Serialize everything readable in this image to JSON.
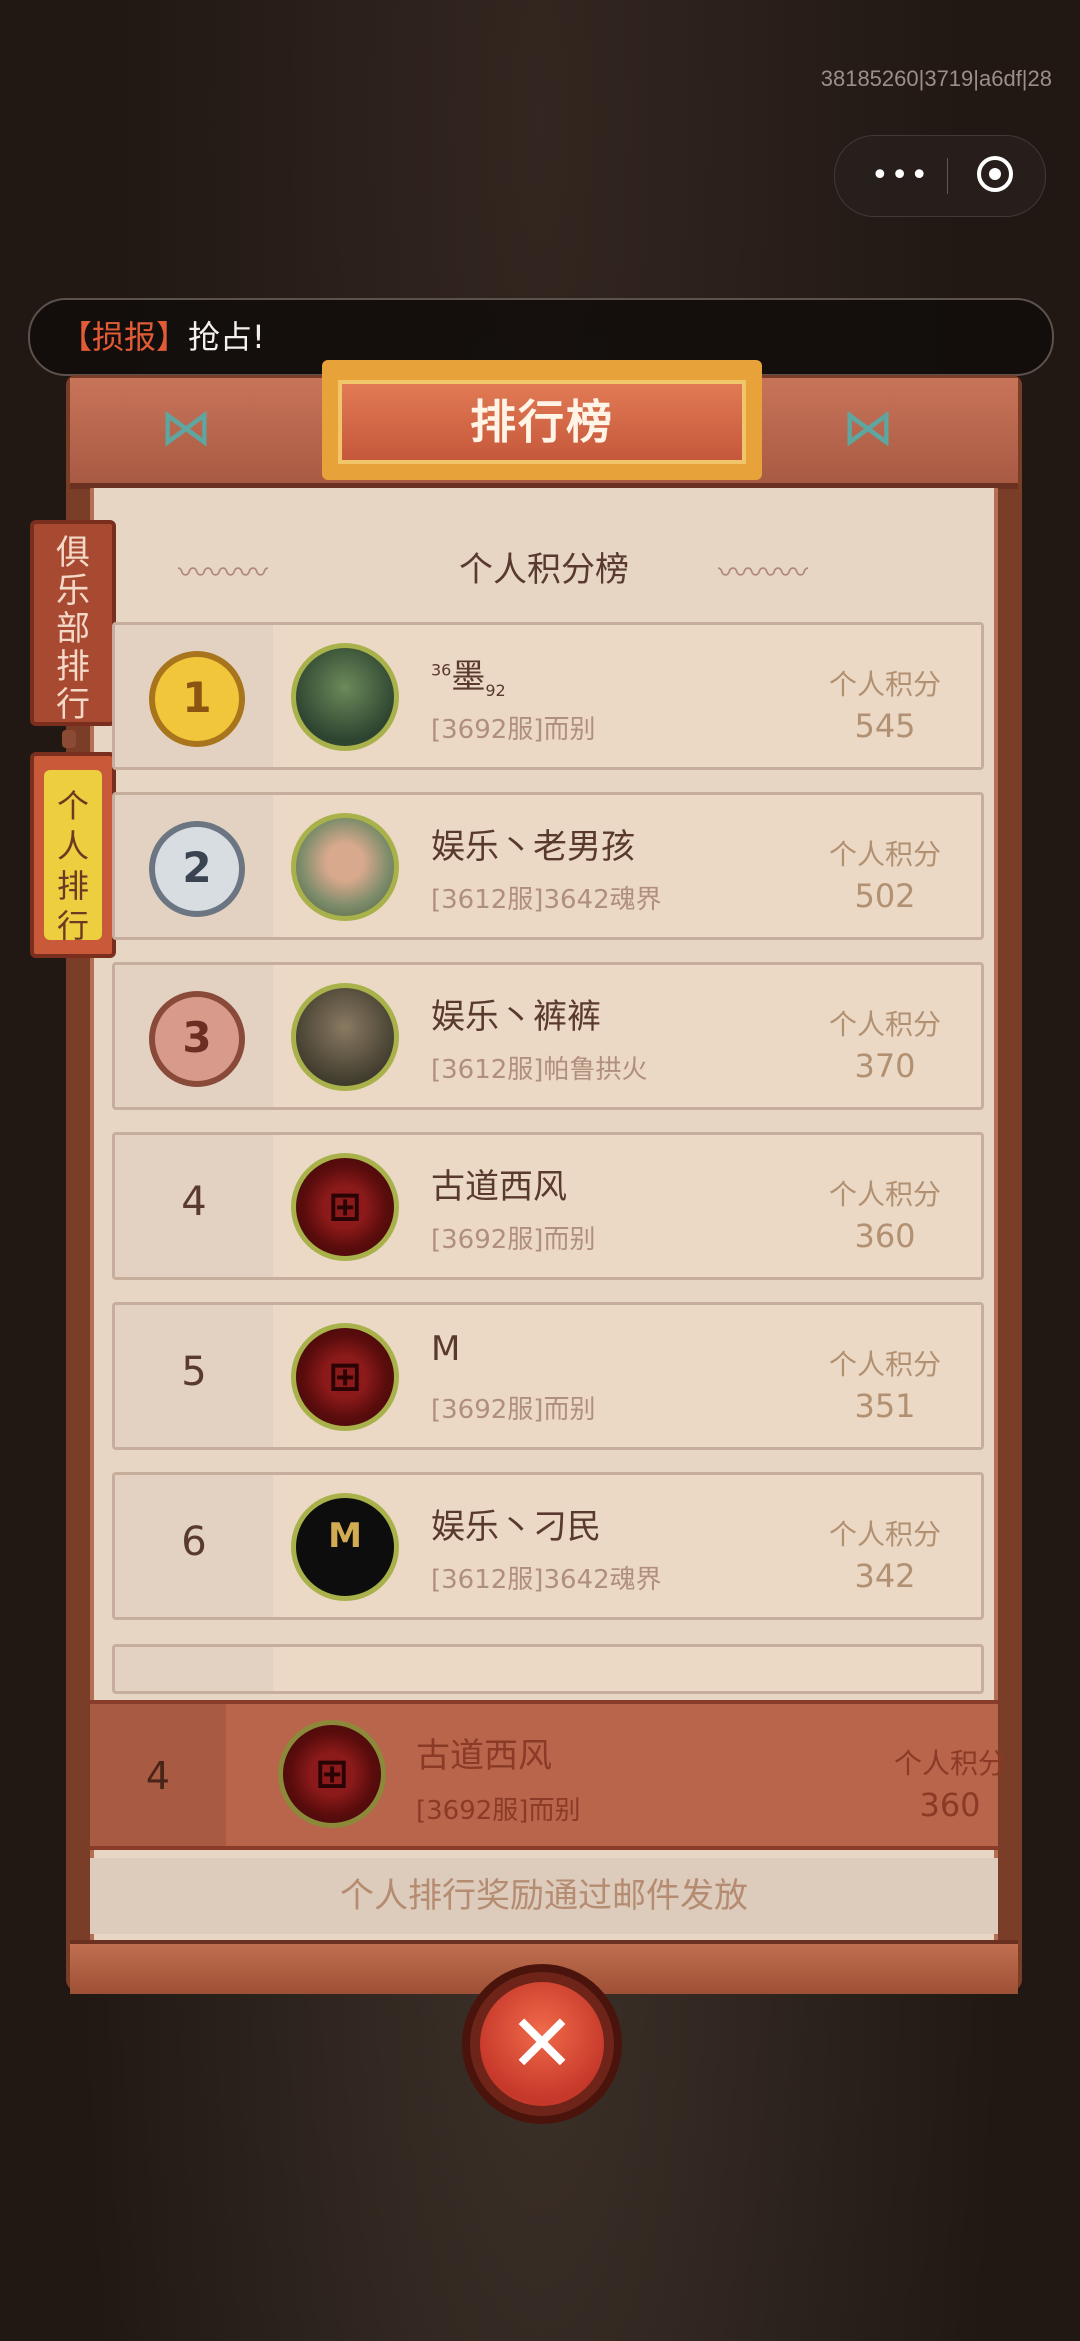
{
  "status": {
    "build_id": "38185260|3719|a6df|28"
  },
  "capsule": {
    "more_icon": "more-dots-icon",
    "close_icon": "target-icon"
  },
  "news": {
    "tag": "【损报】",
    "message": "抢占!"
  },
  "board": {
    "title": "排行榜",
    "subtitle": "个人积分榜",
    "side_tabs": [
      {
        "label": "俱乐部排行",
        "active": false
      },
      {
        "label": "个人排行",
        "active": true
      }
    ],
    "score_label": "个人积分",
    "rows": [
      {
        "rank": "1",
        "name_pre": "36",
        "name": "墨",
        "name_post": "92",
        "server": "[3692服]而别",
        "score": "545",
        "medal": "gold"
      },
      {
        "rank": "2",
        "name": "娱乐丶老男孩",
        "server": "[3612服]3642魂界",
        "score": "502",
        "medal": "silver"
      },
      {
        "rank": "3",
        "name": "娱乐丶裤裤",
        "server": "[3612服]帕鲁拱火",
        "score": "370",
        "medal": "bronze"
      },
      {
        "rank": "4",
        "name": "古道西风",
        "server": "[3692服]而别",
        "score": "360"
      },
      {
        "rank": "5",
        "name": "M",
        "server": "[3692服]而别",
        "score": "351"
      },
      {
        "rank": "6",
        "name": "娱乐丶刁民",
        "server": "[3612服]3642魂界",
        "score": "342"
      }
    ],
    "my_row": {
      "rank": "4",
      "name": "古道西风",
      "server": "[3692服]而别",
      "score": "360"
    },
    "reward_note": "个人排行奖励通过邮件发放"
  },
  "colors": {
    "accent": "#c5583b",
    "gold": "#e7a23a",
    "tab_active": "#ecce3f"
  }
}
